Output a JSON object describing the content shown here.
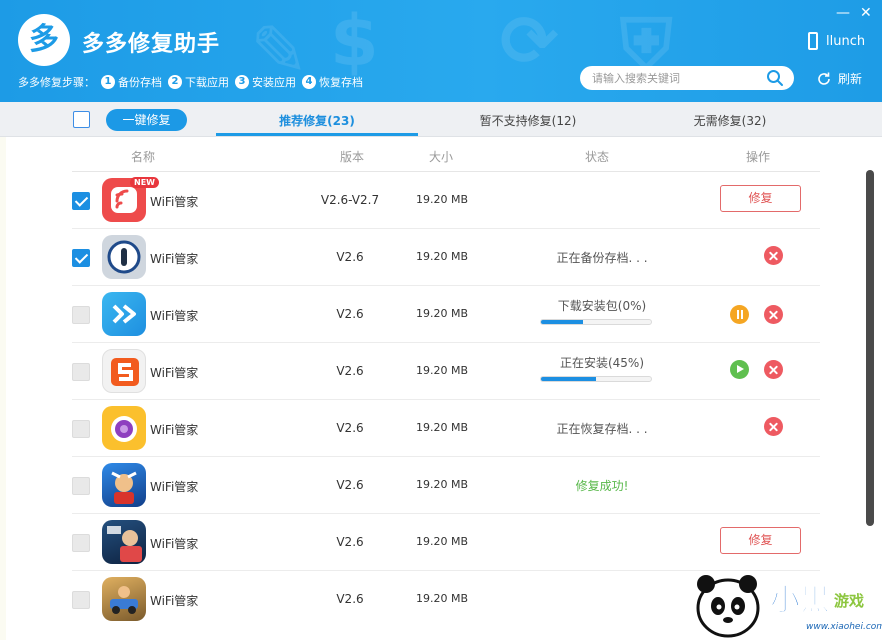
{
  "app": {
    "title": "多多修复助手",
    "logo_char": "多"
  },
  "steps": {
    "label": "多多修复步骤：",
    "items": [
      {
        "num": "1",
        "label": "备份存档"
      },
      {
        "num": "2",
        "label": "下载应用"
      },
      {
        "num": "3",
        "label": "安装应用"
      },
      {
        "num": "4",
        "label": "恢复存档"
      }
    ]
  },
  "window_controls": {
    "minimize": "—",
    "close": "✕"
  },
  "device": {
    "name": "llunch"
  },
  "search": {
    "placeholder": "请输入搜索关键词"
  },
  "refresh": {
    "label": "刷新"
  },
  "toolbar": {
    "one_key_label": "一键修复"
  },
  "tabs": [
    {
      "label": "推荐修复(23)",
      "active": true
    },
    {
      "label": "暂不支持修复(12)",
      "active": false
    },
    {
      "label": "无需修复(32)",
      "active": false
    }
  ],
  "columns": {
    "name": "名称",
    "version": "版本",
    "size": "大小",
    "status": "状态",
    "action": "操作"
  },
  "rows": [
    {
      "name": "WiFi管家",
      "version": "V2.6-V2.7",
      "size": "19.20 MB",
      "status": "",
      "checked": true,
      "badge": "NEW",
      "icon": "wifi-manager-icon",
      "icon_color": "#ee4b4b",
      "action": "修复"
    },
    {
      "name": "WiFi管家",
      "version": "V2.6",
      "size": "19.20 MB",
      "status": "正在备份存档. . .",
      "checked": true,
      "icon": "password-lock-icon",
      "icon_color": "#cfd6de"
    },
    {
      "name": "WiFi管家",
      "version": "V2.6",
      "size": "19.20 MB",
      "status": "下载安装包(0%)",
      "progress": 0.38,
      "checked": false,
      "icon": "swiftkey-icon",
      "icon_color": "#2aa6e8"
    },
    {
      "name": "WiFi管家",
      "version": "V2.6",
      "size": "19.20 MB",
      "status": "正在安装(45%)",
      "progress": 0.5,
      "checked": false,
      "icon": "sogou-icon",
      "icon_color": "#f2f2f2"
    },
    {
      "name": "WiFi管家",
      "version": "V2.6",
      "size": "19.20 MB",
      "status": "正在恢复存档. . .",
      "checked": false,
      "icon": "camera-icon",
      "icon_color": "#fbc02d"
    },
    {
      "name": "WiFi管家",
      "version": "V2.6",
      "size": "19.20 MB",
      "status": "修复成功!",
      "checked": false,
      "icon": "game-hero-icon",
      "icon_color": "#1e6fd9"
    },
    {
      "name": "WiFi管家",
      "version": "V2.6",
      "size": "19.20 MB",
      "status": "",
      "checked": false,
      "icon": "fifa-icon",
      "icon_color": "#17345f",
      "action": "修复"
    },
    {
      "name": "WiFi管家",
      "version": "V2.6",
      "size": "19.20 MB",
      "status": "",
      "checked": false,
      "icon": "car-game-icon",
      "icon_color": "#8a6d3b"
    }
  ],
  "watermark": {
    "brand": "小黑游戏",
    "url": "www.xiaohei.com"
  }
}
